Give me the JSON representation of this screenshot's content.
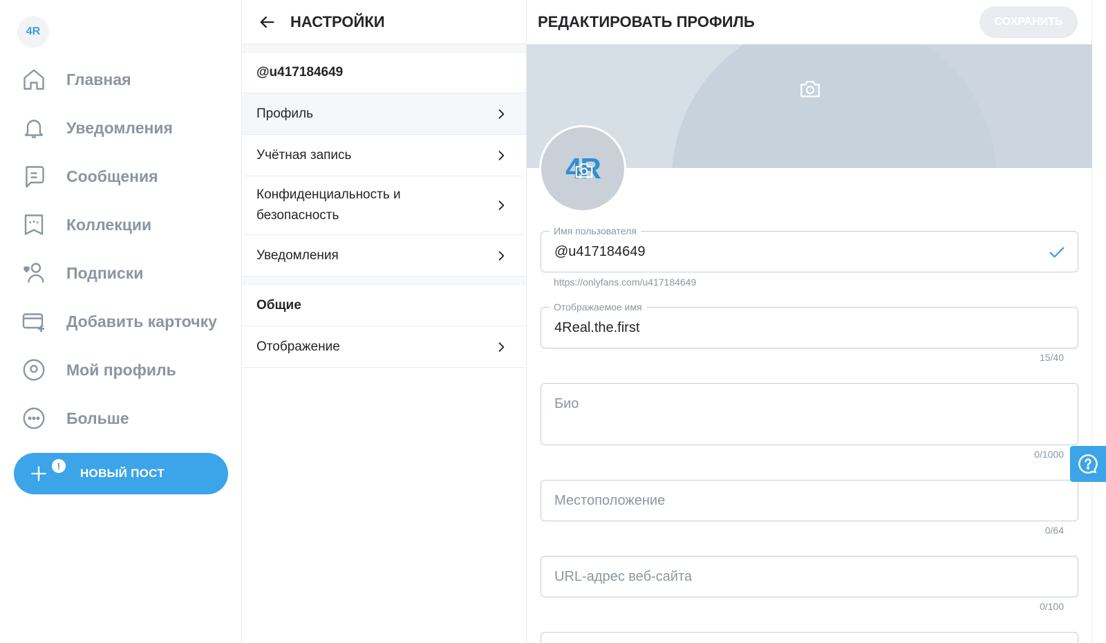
{
  "nav": {
    "avatar_initials": "4R",
    "items": [
      {
        "label": "Главная",
        "icon": "home-icon"
      },
      {
        "label": "Уведомления",
        "icon": "bell-icon"
      },
      {
        "label": "Сообщения",
        "icon": "message-icon"
      },
      {
        "label": "Коллекции",
        "icon": "collections-icon"
      },
      {
        "label": "Подписки",
        "icon": "subscriptions-icon"
      },
      {
        "label": "Добавить карточку",
        "icon": "add-card-icon"
      },
      {
        "label": "Мой профиль",
        "icon": "profile-icon"
      },
      {
        "label": "Больше",
        "icon": "more-icon"
      }
    ],
    "new_post_label": "НОВЫЙ ПОСТ",
    "new_post_badge": "!"
  },
  "settings": {
    "title": "НАСТРОЙКИ",
    "username": "@u417184649",
    "items": [
      {
        "label": "Профиль"
      },
      {
        "label": "Учётная запись"
      },
      {
        "label": "Конфиденциальность и безопасность"
      },
      {
        "label": "Уведомления"
      }
    ],
    "section_general": "Общие",
    "general_items": [
      {
        "label": "Отображение"
      }
    ]
  },
  "edit_profile": {
    "title": "РЕДАКТИРОВАТЬ ПРОФИЛЬ",
    "save_label": "СОХРАНИТЬ",
    "avatar_initials": "4R",
    "username": {
      "legend": "Имя пользователя",
      "value": "@u417184649",
      "hint": "https://onlyfans.com/u417184649"
    },
    "display_name": {
      "legend": "Отображаемое имя",
      "value": "4Real.the.first",
      "counter": "15/40"
    },
    "bio": {
      "placeholder": "Био",
      "counter": "0/1000"
    },
    "location": {
      "placeholder": "Местоположение",
      "counter": "0/64"
    },
    "website": {
      "placeholder": "URL-адрес веб-сайта",
      "counter": "0/100"
    }
  },
  "colors": {
    "accent": "#3ca4e8",
    "muted": "#8a96a3",
    "text": "#242529",
    "border": "#eaecef"
  }
}
